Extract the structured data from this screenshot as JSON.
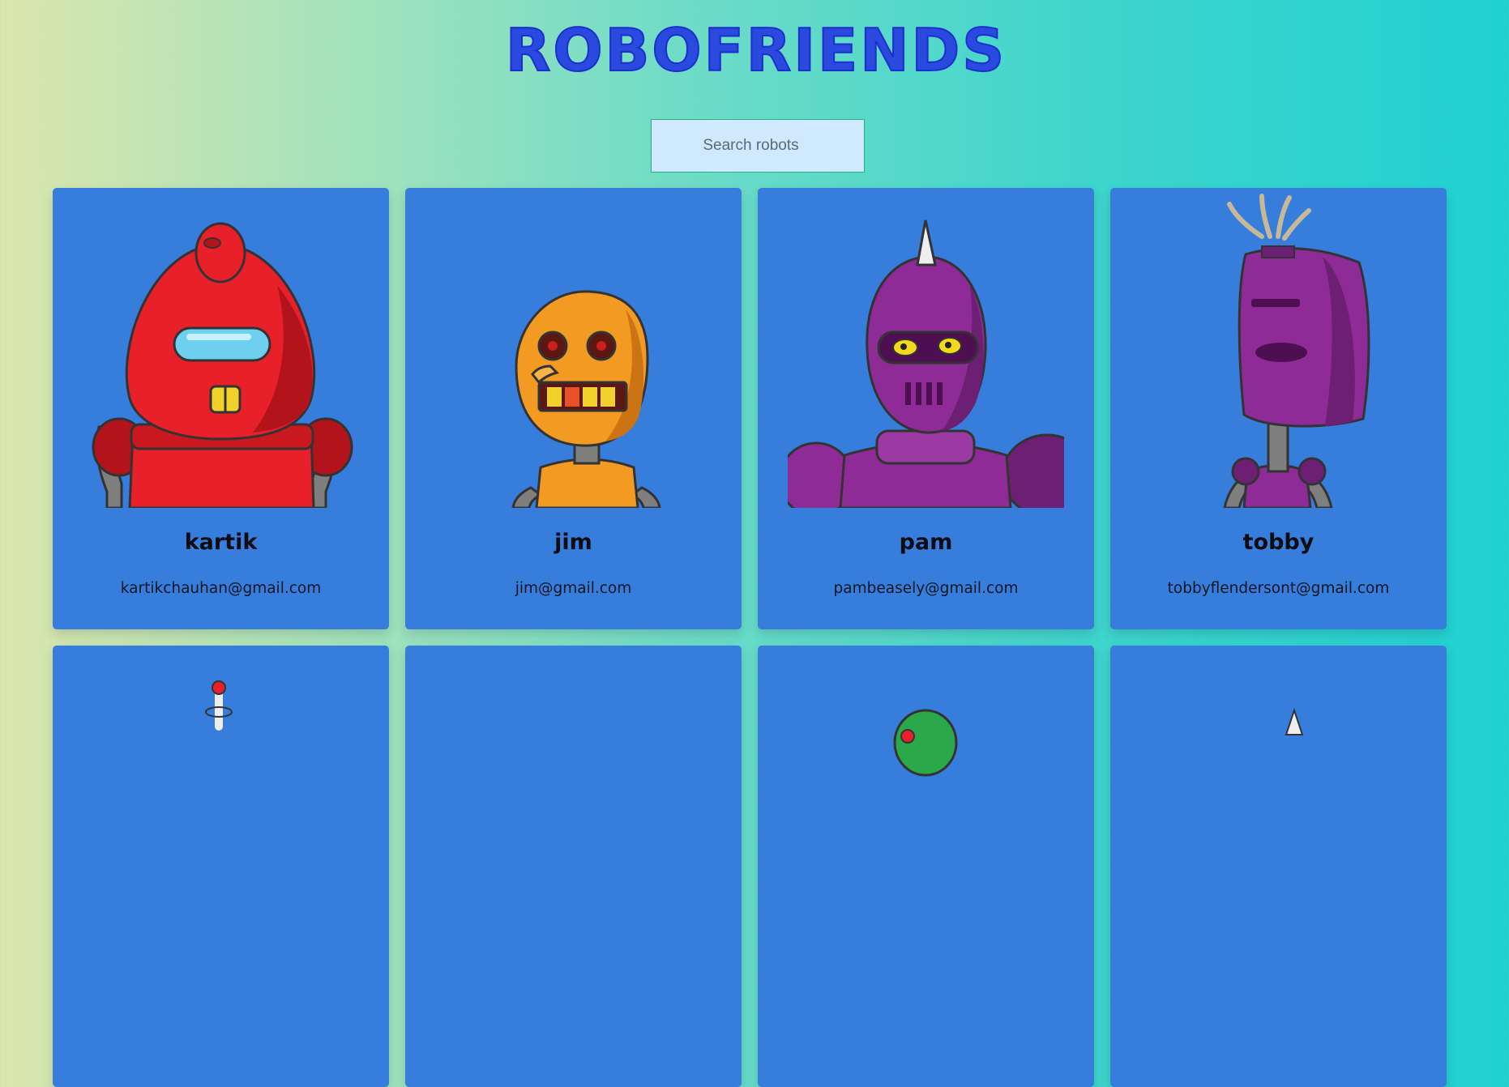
{
  "header": {
    "title": "ROBOFRIENDS"
  },
  "search": {
    "placeholder": "Search robots",
    "value": ""
  },
  "robots": [
    {
      "name": "kartik",
      "email": "kartikchauhan@gmail.com",
      "color": "#e8202a"
    },
    {
      "name": "jim",
      "email": "jim@gmail.com",
      "color": "#f39a23"
    },
    {
      "name": "pam",
      "email": "pambeasely@gmail.com",
      "color": "#8e2b96"
    },
    {
      "name": "tobby",
      "email": "tobbyflendersont@gmail.com",
      "color": "#8e2b96"
    },
    {
      "name": "",
      "email": "",
      "color": "#e8202a"
    },
    {
      "name": "",
      "email": "",
      "color": "#367ddc"
    },
    {
      "name": "",
      "email": "",
      "color": "#2aa84a"
    },
    {
      "name": "",
      "email": "",
      "color": "#dddddd"
    }
  ],
  "theme": {
    "card": "#367ddc",
    "title": "#2a49df"
  }
}
